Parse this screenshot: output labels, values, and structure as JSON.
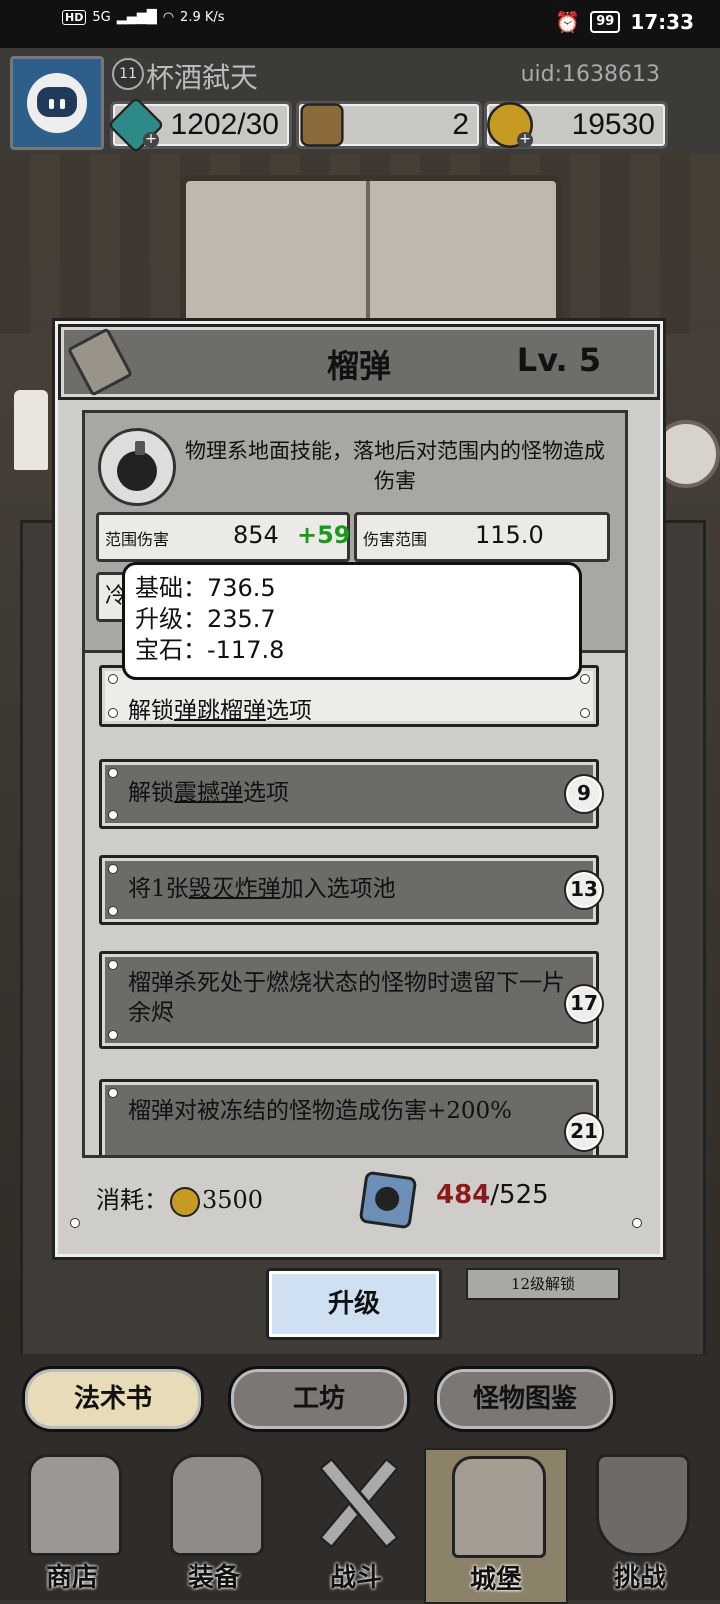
{
  "status_bar": {
    "network": "HD",
    "signal": "5G",
    "speed": "2.9 K/s",
    "battery": "99",
    "time": "17:33"
  },
  "player": {
    "level": "11",
    "name": "杯酒弑天",
    "uid": "uid:1638613"
  },
  "resources": {
    "energy": "1202/30",
    "items": "2",
    "gold": "19530"
  },
  "skill": {
    "name": "榴弹",
    "level": "Lv. 5",
    "description": "物理系地面技能，落地后对范围内的怪物造成伤害",
    "stats": {
      "damage_label": "范围伤害",
      "damage_value": "854",
      "damage_bonus": "+59",
      "range_label": "伤害范围",
      "range_value": "115.0",
      "cooldown_partial": "冷"
    },
    "tooltip": {
      "line1": "基础：736.5",
      "line2": "升级：235.7",
      "line3": "宝石：-117.8"
    },
    "options": [
      {
        "pre": "解锁",
        "link": "弹跳榴弹",
        "post": "选项",
        "unlock_level": ""
      },
      {
        "pre": "解锁",
        "link": "震撼弹",
        "post": "选项",
        "unlock_level": "9"
      },
      {
        "pre": "将1张",
        "link": "毁灭炸弹",
        "post": "加入选项池",
        "unlock_level": "13"
      },
      {
        "pre": "榴弹杀死处于燃烧状态的怪物时遗留下一片余烬",
        "link": "",
        "post": "",
        "unlock_level": "17"
      },
      {
        "pre": "榴弹对被冻结的怪物造成伤害+200%",
        "link": "",
        "post": "",
        "unlock_level": "21"
      }
    ],
    "cost_label": "消耗：",
    "cost_gold": "3500",
    "shards_have": "484",
    "shards_need": "/525",
    "upgrade_button": "升级",
    "lock_note": "12级解锁"
  },
  "tabs": [
    {
      "label": "法术书",
      "active": true
    },
    {
      "label": "工坊",
      "active": false
    },
    {
      "label": "怪物图鉴",
      "active": false
    }
  ],
  "bottom_nav": [
    {
      "label": "商店",
      "icon": "shop-icon"
    },
    {
      "label": "装备",
      "icon": "backpack-icon"
    },
    {
      "label": "战斗",
      "icon": "swords-icon"
    },
    {
      "label": "城堡",
      "icon": "castle-icon"
    },
    {
      "label": "挑战",
      "icon": "lock-shield-icon"
    }
  ],
  "colors": {
    "bonus_green": "#1a9a1a",
    "shard_red": "#8b1a1a",
    "upgrade_button": "#cfe0f2",
    "active_tab": "#e8dcb8"
  }
}
